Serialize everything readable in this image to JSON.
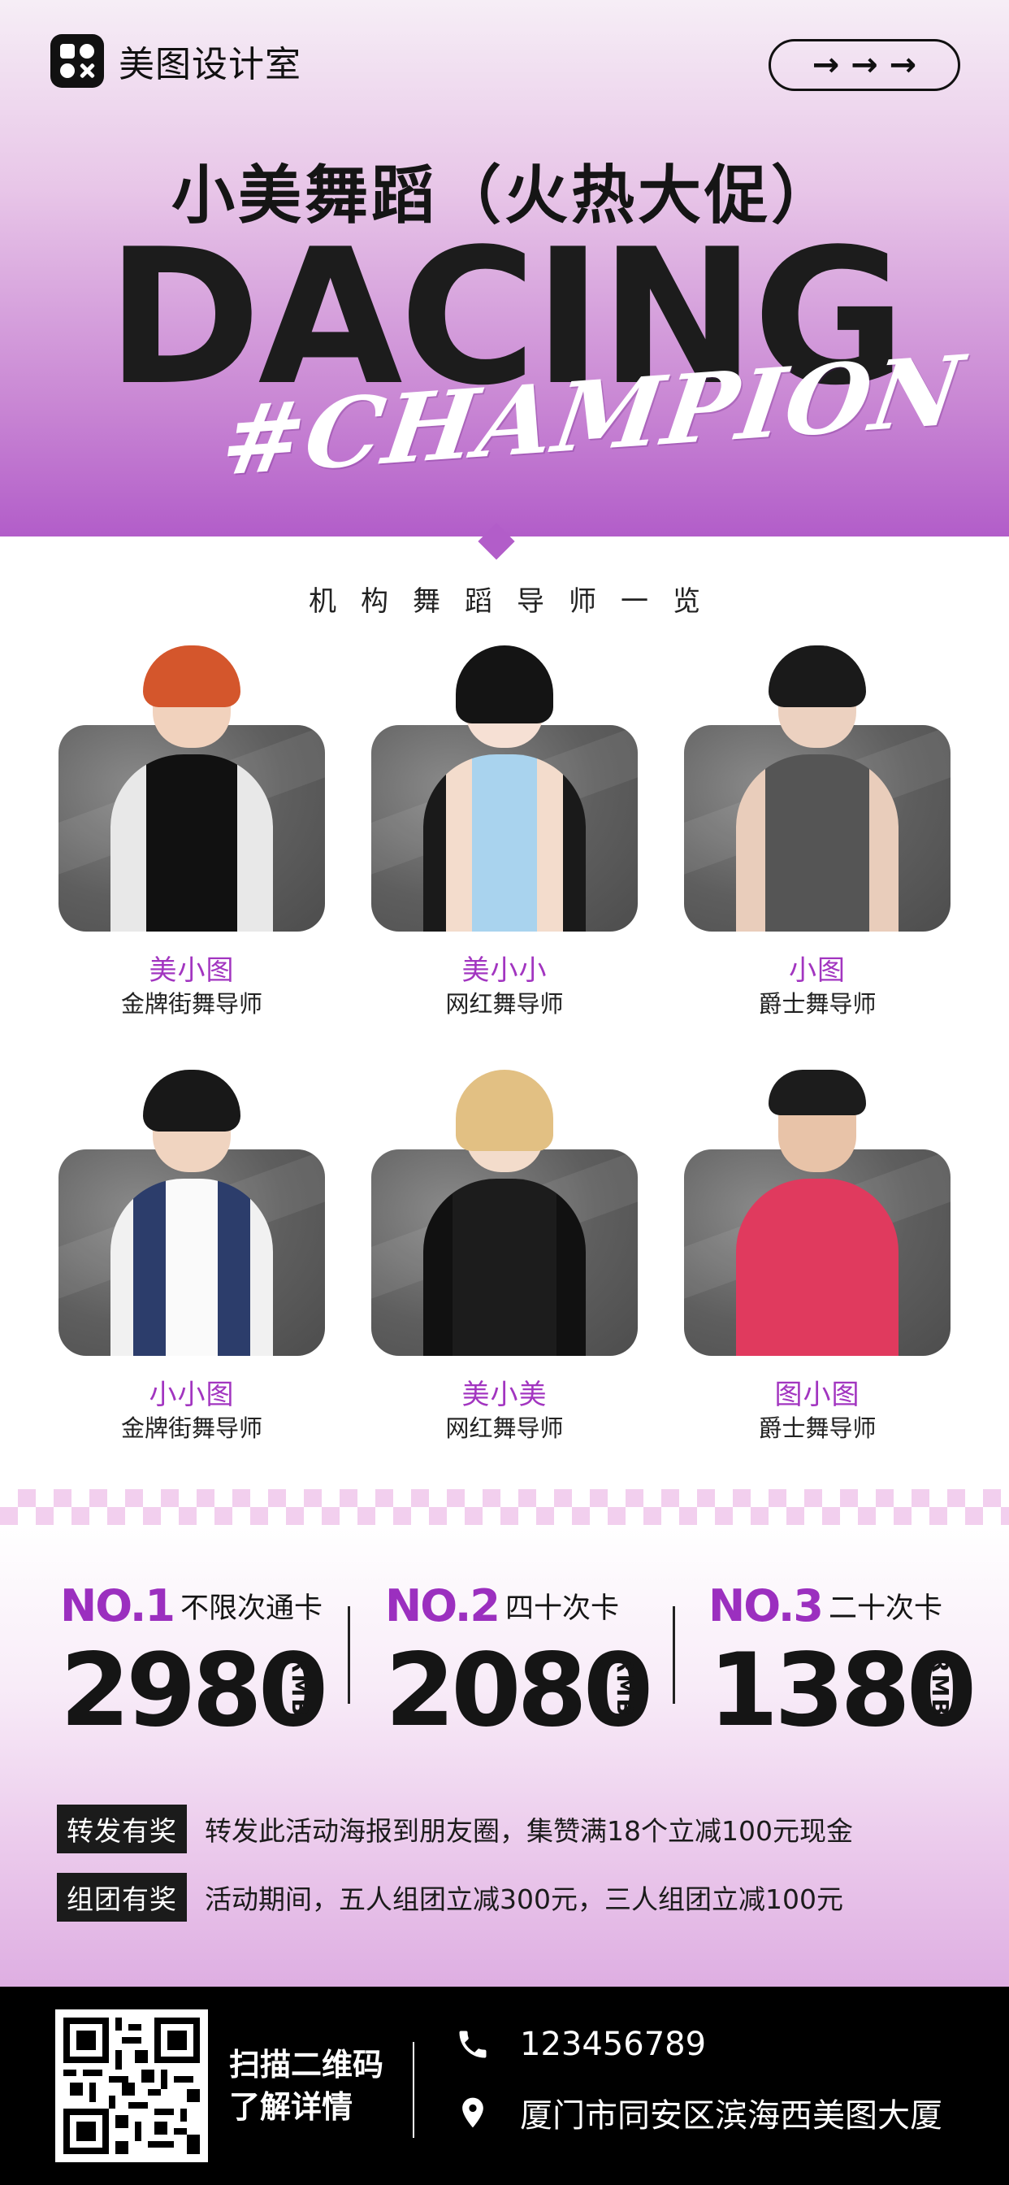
{
  "header": {
    "brand": "美图设计室",
    "arrows": "→ → →",
    "title": "小美舞蹈（火热大促）",
    "big_word": "DACING",
    "script_word": "#CHAMPION"
  },
  "instructors": {
    "section_title": "机构舞蹈导师一览",
    "items": [
      {
        "name": "美小图",
        "role": "金牌街舞导师"
      },
      {
        "name": "美小小",
        "role": "网红舞导师"
      },
      {
        "name": "小图",
        "role": "爵士舞导师"
      },
      {
        "name": "小小图",
        "role": "金牌街舞导师"
      },
      {
        "name": "美小美",
        "role": "网红舞导师"
      },
      {
        "name": "图小图",
        "role": "爵士舞导师"
      }
    ]
  },
  "pricing": [
    {
      "no": "NO.1",
      "name": "不限次通卡",
      "amount": "2980",
      "unit": "RMB"
    },
    {
      "no": "NO.2",
      "name": "四十次卡",
      "amount": "2080",
      "unit": "RMB"
    },
    {
      "no": "NO.3",
      "name": "二十次卡",
      "amount": "1380",
      "unit": "RMB"
    }
  ],
  "promos": [
    {
      "tag": "转发有奖",
      "text": "转发此活动海报到朋友圈，集赞满18个立减100元现金"
    },
    {
      "tag": "组团有奖",
      "text": "活动期间，五人组团立减300元，三人组团立减100元"
    }
  ],
  "footer": {
    "scan_line1": "扫描二维码",
    "scan_line2": "了解详情",
    "phone": "123456789",
    "address": "厦门市同安区滨海西美图大厦"
  },
  "colors": {
    "accent": "#a235c0",
    "hero_bottom": "#b25dc9",
    "checker": "#f2cfee"
  }
}
